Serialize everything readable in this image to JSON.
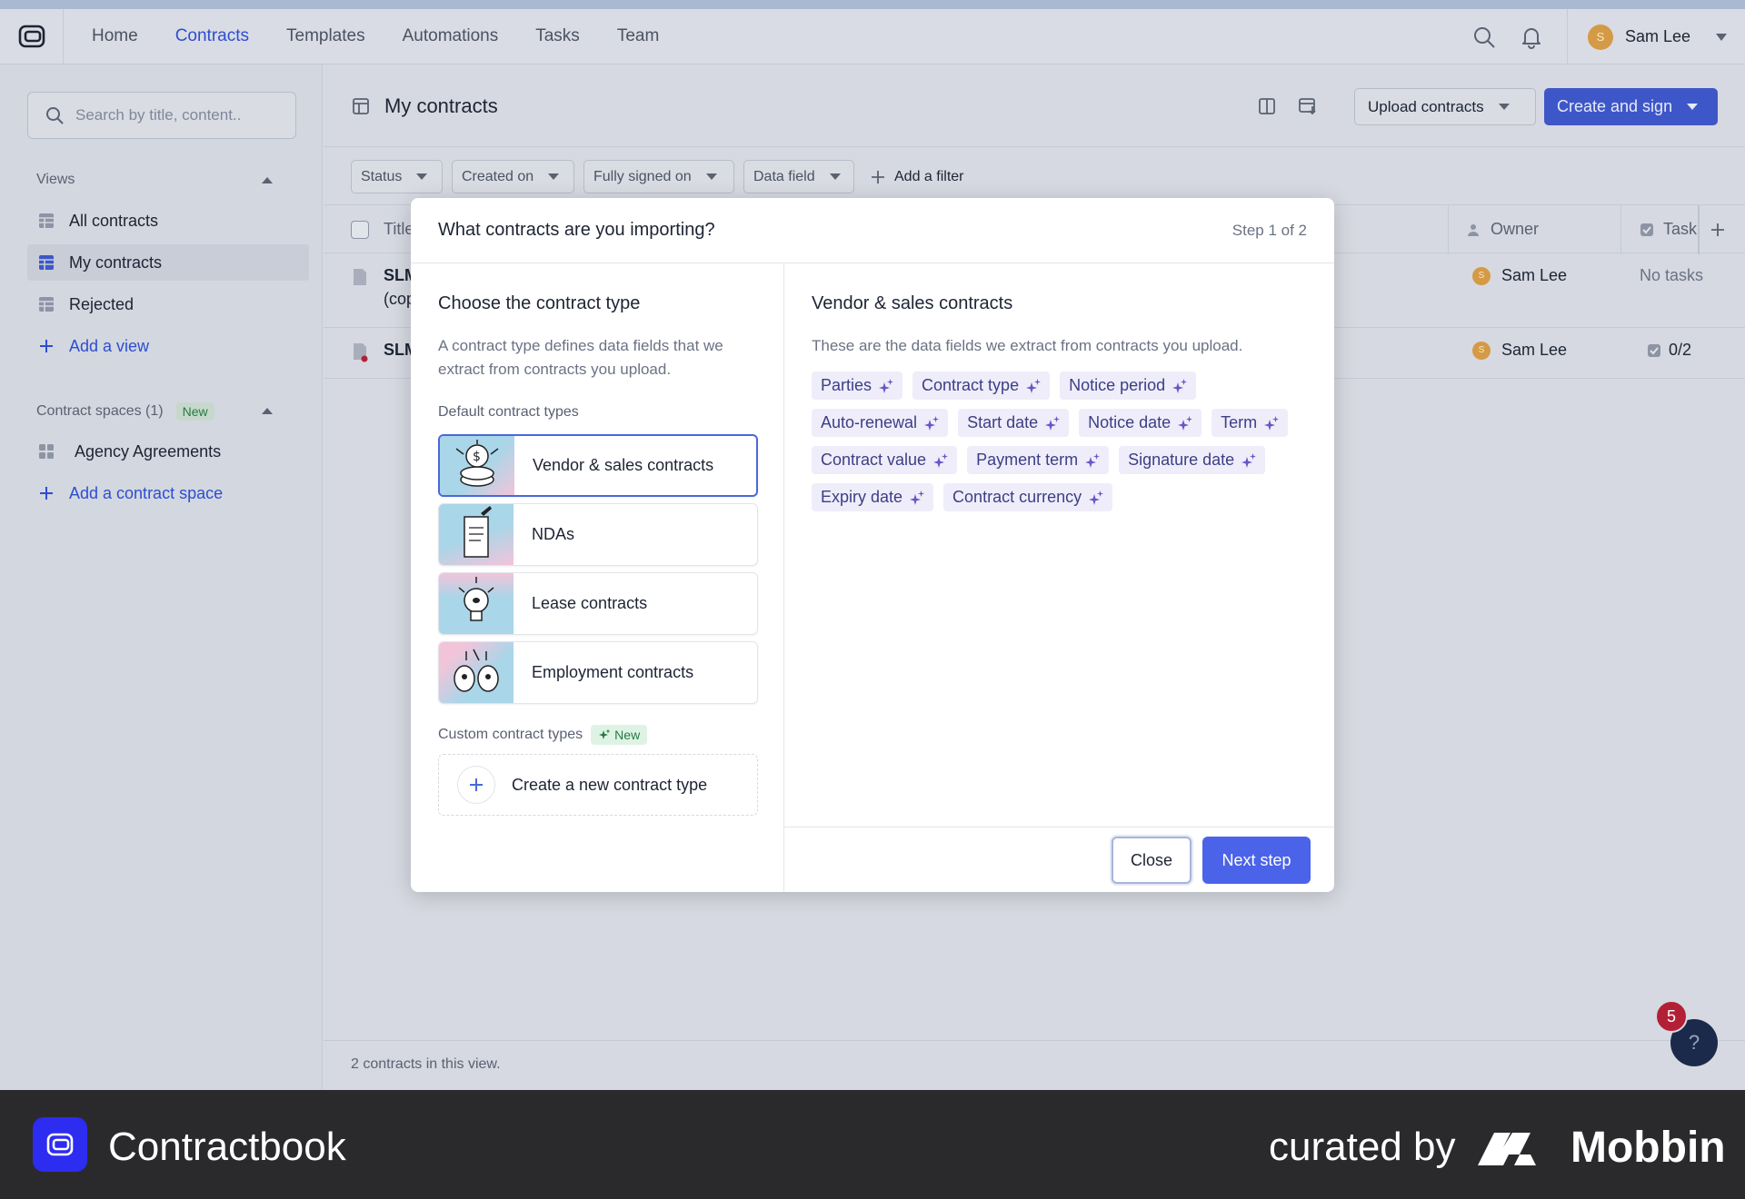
{
  "nav": {
    "items": [
      "Home",
      "Contracts",
      "Templates",
      "Automations",
      "Tasks",
      "Team"
    ],
    "active": "Contracts",
    "user": {
      "initial": "S",
      "name": "Sam Lee"
    }
  },
  "sidebar": {
    "search_placeholder": "Search by title, content..",
    "views_title": "Views",
    "views": [
      {
        "label": "All contracts",
        "active": false
      },
      {
        "label": "My contracts",
        "active": true
      },
      {
        "label": "Rejected",
        "active": false
      }
    ],
    "add_view": "Add a view",
    "spaces_title": "Contract spaces (1)",
    "spaces_badge": "New",
    "spaces": [
      "Agency Agreements"
    ],
    "add_space": "Add a contract space"
  },
  "main": {
    "title": "My contracts",
    "upload_label": "Upload contracts",
    "create_label": "Create and sign",
    "filters": [
      "Status",
      "Created on",
      "Fully signed on",
      "Data field"
    ],
    "add_filter": "Add a filter",
    "columns": {
      "title": "Title",
      "owner": "Owner",
      "tasks": "Task"
    },
    "rows": [
      {
        "title": "SLM",
        "title2": "(cop",
        "owner": "Sam Lee",
        "owner_initial": "S",
        "tasks": "No tasks"
      },
      {
        "title": "SLM",
        "title2": "",
        "owner": "Sam Lee",
        "owner_initial": "S",
        "tasks": "0/2"
      }
    ],
    "footer": "2 contracts in this view."
  },
  "modal": {
    "title": "What contracts are you importing?",
    "step": "Step 1 of 2",
    "left_heading": "Choose the contract type",
    "left_desc": "A contract type defines data fields that we extract from contracts you upload.",
    "default_label": "Default contract types",
    "types": [
      "Vendor & sales contracts",
      "NDAs",
      "Lease contracts",
      "Employment contracts"
    ],
    "selected_type": "Vendor & sales contracts",
    "custom_label": "Custom contract types",
    "custom_badge": "New",
    "create_new": "Create a new contract type",
    "right_heading": "Vendor & sales contracts",
    "right_desc": "These are the data fields we extract from contracts you upload.",
    "fields": [
      "Parties",
      "Contract type",
      "Notice period",
      "Auto-renewal",
      "Start date",
      "Notice date",
      "Term",
      "Contract value",
      "Payment term",
      "Signature date",
      "Expiry date",
      "Contract currency"
    ],
    "close_label": "Close",
    "next_label": "Next step"
  },
  "help": {
    "badge": "5",
    "label": "?"
  },
  "brand": {
    "app": "Contractbook",
    "curated": "curated by",
    "mobbin": "Mobbin"
  },
  "colors": {
    "primary": "#3e57c8",
    "accent": "#4a63e8",
    "tag_bg": "#efedf9",
    "tag_text": "#3b3f86",
    "new_green": "#257a44"
  }
}
